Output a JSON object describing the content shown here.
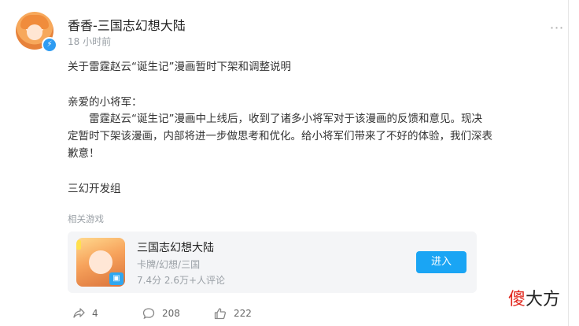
{
  "post": {
    "author": "香香-三国志幻想大陆",
    "time": "18 小时前",
    "title": "关于雷霆赵云“诞生记”漫画暂时下架和调整说明",
    "greeting": "亲爱的小将军：",
    "body": "雷霆赵云“诞生记”漫画中上线后，收到了诸多小将军对于该漫画的反馈和意见。现决定暂时下架该漫画，内部将进一步做思考和优化。给小将军们带来了不好的体验，我们深表歉意！",
    "signature": "三幻开发组"
  },
  "related": {
    "label": "相关游戏",
    "game": {
      "name": "三国志幻想大陆",
      "tags": "卡牌/幻想/三国",
      "rating": "7.4分 2.6万+人评论",
      "enter_label": "进入",
      "icon": "game-icon"
    }
  },
  "actions": {
    "share": "4",
    "comments": "208",
    "likes": "222"
  },
  "watermark": {
    "part1": "傻",
    "part2": "大方"
  },
  "colors": {
    "accent": "#1aa5f4",
    "verified": "#2f9cf2",
    "muted": "#9aa0a6",
    "watermark_red": "#e1251b"
  }
}
